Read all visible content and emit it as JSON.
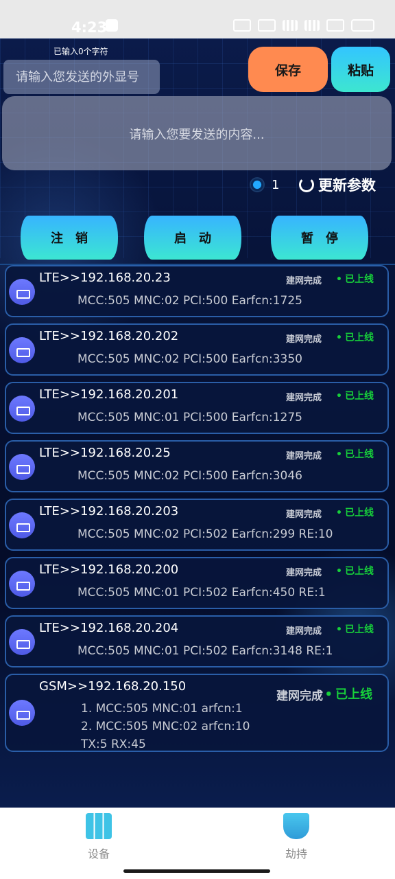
{
  "status_bar": {
    "time": "4:23"
  },
  "form": {
    "char_count": "已输入0个字符",
    "caller_placeholder": "请输入您发送的外显号",
    "save_label": "保存",
    "paste_label": "粘贴",
    "content_placeholder": "请输入您要发送的内容..."
  },
  "options": {
    "radio_label": "1",
    "refresh_label": "更新参数"
  },
  "actions": {
    "logout_label": "注销",
    "start_label": "启动",
    "pause_label": "暂停"
  },
  "devices": [
    {
      "title": "LTE>>192.168.20.23",
      "state": "建网完成",
      "online": "已上线",
      "detail": "MCC:505 MNC:02 PCI:500 Earfcn:1725"
    },
    {
      "title": "LTE>>192.168.20.202",
      "state": "建网完成",
      "online": "已上线",
      "detail": "MCC:505 MNC:02 PCI:500 Earfcn:3350"
    },
    {
      "title": "LTE>>192.168.20.201",
      "state": "建网完成",
      "online": "已上线",
      "detail": "MCC:505 MNC:01 PCI:500 Earfcn:1275"
    },
    {
      "title": "LTE>>192.168.20.25",
      "state": "建网完成",
      "online": "已上线",
      "detail": "MCC:505 MNC:02 PCI:500 Earfcn:3046"
    },
    {
      "title": "LTE>>192.168.20.203",
      "state": "建网完成",
      "online": "已上线",
      "detail": "MCC:505 MNC:02 PCI:502 Earfcn:299 RE:10"
    },
    {
      "title": "LTE>>192.168.20.200",
      "state": "建网完成",
      "online": "已上线",
      "detail": "MCC:505 MNC:01 PCI:502 Earfcn:450 RE:1"
    },
    {
      "title": "LTE>>192.168.20.204",
      "state": "建网完成",
      "online": "已上线",
      "detail": "MCC:505 MNC:01 PCI:502 Earfcn:3148 RE:1"
    }
  ],
  "gsm": {
    "title": "GSM>>192.168.20.150",
    "state": "建网完成",
    "online": "已上线",
    "line1": "1. MCC:505 MNC:01 arfcn:1",
    "line2": "2. MCC:505 MNC:02 arfcn:10",
    "line3": "TX:5 RX:45"
  },
  "bottom_nav": {
    "devices_label": "设备",
    "hijack_label": "劫持"
  },
  "colors": {
    "save_bg": "#ff8a50",
    "accent_cyan": "#37b4ff",
    "online_green": "#17d13a",
    "bg_dark": "#061236"
  }
}
